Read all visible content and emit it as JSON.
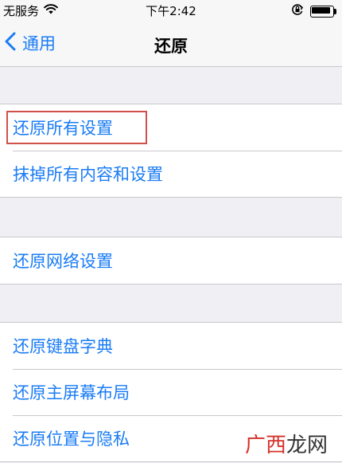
{
  "status_bar": {
    "carrier": "无服务",
    "time": "下午2:42",
    "icons": [
      "wifi-icon",
      "rotation-lock-icon",
      "battery-icon"
    ]
  },
  "nav": {
    "back_label": "通用",
    "title": "还原"
  },
  "groups": [
    {
      "items": [
        "还原所有设置",
        "抹掉所有内容和设置"
      ]
    },
    {
      "items": [
        "还原网络设置"
      ]
    },
    {
      "items": [
        "还原键盘字典",
        "还原主屏幕布局",
        "还原位置与隐私"
      ]
    }
  ],
  "highlighted_item": "还原所有设置",
  "watermark": {
    "part1": "广西",
    "part2": "龙网"
  },
  "colors": {
    "accent": "#1a7cf5",
    "background": "#efeff4",
    "highlight": "#d0504a",
    "watermark_red": "#d4322a"
  }
}
